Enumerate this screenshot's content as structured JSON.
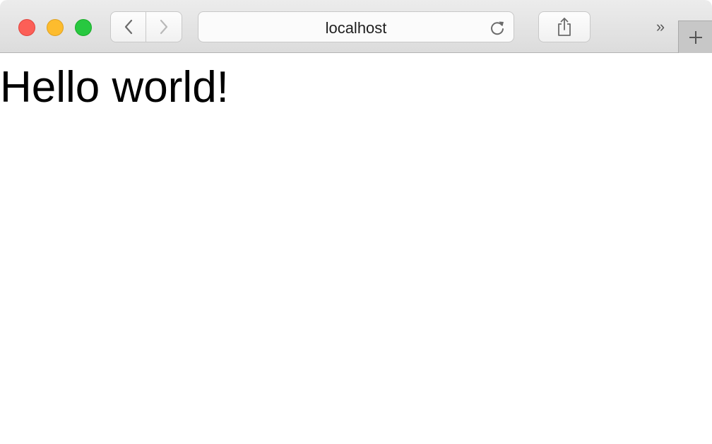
{
  "window": {
    "controls": [
      "close",
      "minimize",
      "zoom"
    ],
    "colors": {
      "close": "#fc5f57",
      "minimize": "#fdbc2e",
      "zoom": "#28c840"
    }
  },
  "toolbar": {
    "back_icon": "chevron-left-icon",
    "forward_icon": "chevron-right-icon",
    "address": "localhost",
    "reload_icon": "reload-icon",
    "share_icon": "share-icon",
    "overflow_label": "»",
    "new_tab_icon": "plus-icon"
  },
  "page": {
    "heading": "Hello world!"
  }
}
